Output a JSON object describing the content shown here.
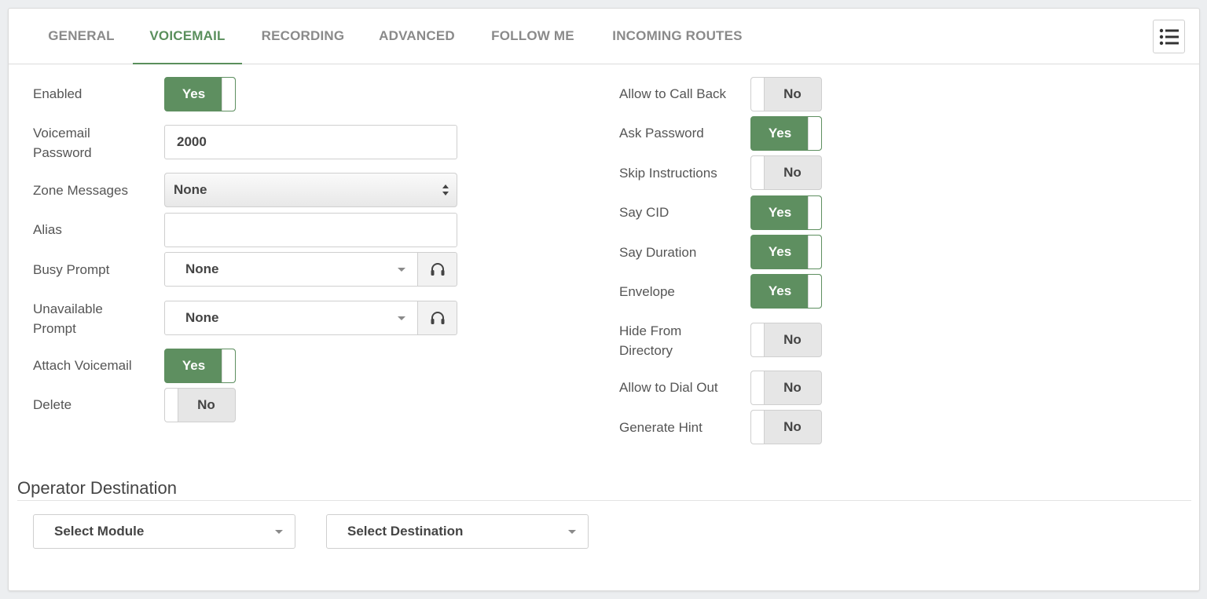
{
  "tabs": [
    {
      "label": "GENERAL",
      "active": false
    },
    {
      "label": "VOICEMAIL",
      "active": true
    },
    {
      "label": "RECORDING",
      "active": false
    },
    {
      "label": "ADVANCED",
      "active": false
    },
    {
      "label": "FOLLOW ME",
      "active": false
    },
    {
      "label": "INCOMING ROUTES",
      "active": false
    }
  ],
  "menu_icon": "list-icon",
  "left": {
    "enabled": {
      "label": "Enabled",
      "value": "Yes"
    },
    "voicemail_password": {
      "label_line1": "Voicemail",
      "label_line2": "Password",
      "value": "2000"
    },
    "zone_messages": {
      "label": "Zone Messages",
      "value": "None"
    },
    "alias": {
      "label": "Alias",
      "value": ""
    },
    "busy_prompt": {
      "label": "Busy Prompt",
      "value": "None",
      "icon": "headphones-icon"
    },
    "unavailable_prompt": {
      "label_line1": "Unavailable",
      "label_line2": "Prompt",
      "value": "None",
      "icon": "headphones-icon"
    },
    "attach_voicemail": {
      "label": "Attach Voicemail",
      "value": "Yes"
    },
    "delete": {
      "label": "Delete",
      "value": "No"
    }
  },
  "right": {
    "allow_call_back": {
      "label": "Allow to Call Back",
      "value": "No"
    },
    "ask_password": {
      "label": "Ask Password",
      "value": "Yes"
    },
    "skip_instructions": {
      "label": "Skip Instructions",
      "value": "No"
    },
    "say_cid": {
      "label": "Say CID",
      "value": "Yes"
    },
    "say_duration": {
      "label": "Say Duration",
      "value": "Yes"
    },
    "envelope": {
      "label": "Envelope",
      "value": "Yes"
    },
    "hide_from_directory": {
      "label_line1": "Hide From",
      "label_line2": "Directory",
      "value": "No"
    },
    "allow_dial_out": {
      "label": "Allow to Dial Out",
      "value": "No"
    },
    "generate_hint": {
      "label": "Generate Hint",
      "value": "No"
    }
  },
  "operator_destination": {
    "title": "Operator Destination",
    "module": "Select Module",
    "destination": "Select Destination"
  },
  "colors": {
    "accent": "#5a8f5c",
    "toggle_on": "#5e8f60",
    "toggle_off": "#e6e6e6",
    "tab_inactive": "#8a8a8a"
  }
}
